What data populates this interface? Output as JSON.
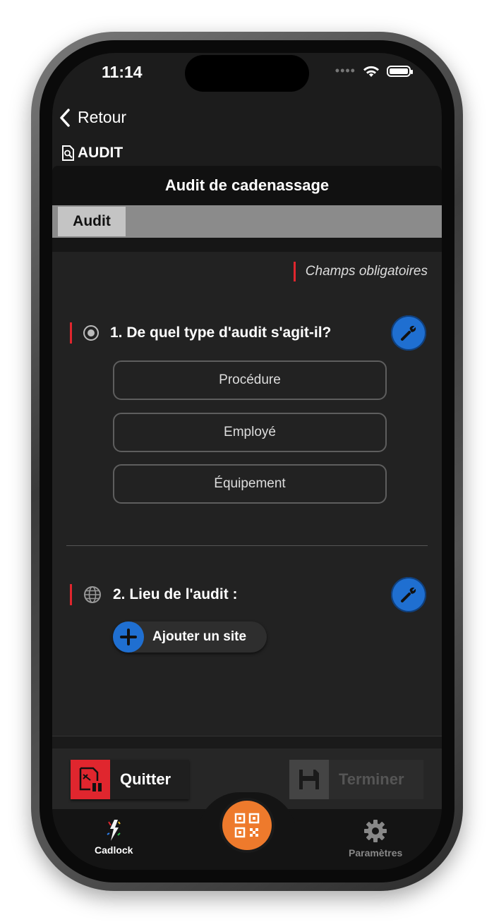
{
  "status": {
    "time": "11:14"
  },
  "nav": {
    "back_label": "Retour",
    "section_title": "AUDIT"
  },
  "form": {
    "title": "Audit de cadenassage",
    "tab_label": "Audit",
    "required_note": "Champs obligatoires"
  },
  "questions": [
    {
      "label": "1. De quel type d'audit s'agit-il?",
      "options": [
        "Procédure",
        "Employé",
        "Équipement"
      ]
    },
    {
      "label": "2. Lieu de l'audit :",
      "add_site_label": "Ajouter un site"
    }
  ],
  "actions": {
    "quit_label": "Quitter",
    "finish_label": "Terminer"
  },
  "tabbar": {
    "cadlock_label": "Cadlock",
    "settings_label": "Paramètres"
  },
  "colors": {
    "accent_blue": "#1f6fd1",
    "accent_red": "#e0262e",
    "accent_orange": "#ee7a2c"
  }
}
